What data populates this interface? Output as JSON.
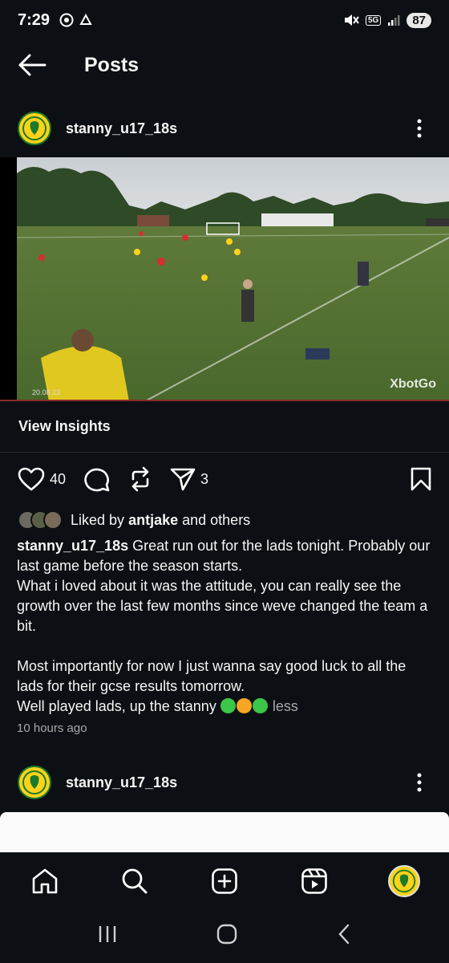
{
  "status": {
    "time": "7:29",
    "battery": "87",
    "network": "5G"
  },
  "header": {
    "title": "Posts"
  },
  "post": {
    "username": "stanny_u17_18s",
    "photo_date": "20.08.23",
    "photo_watermark": "XbotGo",
    "insights_label": "View Insights",
    "likes_count": "40",
    "shares_count": "3",
    "liked_by_prefix": "Liked by ",
    "liked_by_user": "antjake",
    "liked_by_suffix": " and others",
    "caption_first": " Great run out for the lads tonight. Probably our last game before the season starts.",
    "caption_line2": "What i loved about it was the attitude, you can really see the growth over the last few months since weve changed the team a bit.",
    "caption_line3": "Most importantly for now I just wanna say good luck to all the lads for their gcse results tomorrow.",
    "caption_line4": "Well played lads, up the stanny ",
    "less_label": "less",
    "timestamp": "10 hours ago"
  },
  "next_post": {
    "username": "stanny_u17_18s"
  },
  "colors": {
    "background": "#0c1014",
    "badge_yellow": "#ffd21a",
    "badge_green": "#1a7a2d",
    "muted": "#a8a8a8"
  },
  "icons": {
    "back": "arrow-left-icon",
    "more": "more-vertical-icon",
    "like": "heart-icon",
    "comment": "comment-icon",
    "repost": "repost-icon",
    "share": "send-icon",
    "save": "bookmark-icon",
    "home": "home-icon",
    "search": "search-icon",
    "create": "plus-square-icon",
    "reels": "reels-icon"
  }
}
